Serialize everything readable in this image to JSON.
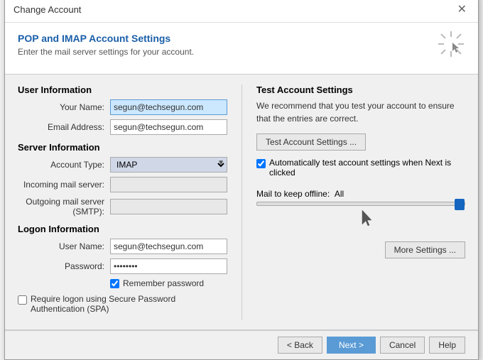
{
  "dialog": {
    "title": "Change Account",
    "close_label": "✕"
  },
  "header": {
    "title": "POP and IMAP Account Settings",
    "subtitle": "Enter the mail server settings for your account."
  },
  "left": {
    "user_info_label": "User Information",
    "your_name_label": "Your Name:",
    "your_name_value": "segun@techsegun.com",
    "email_label": "Email Address:",
    "email_value": "segun@techsegun.com",
    "server_info_label": "Server Information",
    "account_type_label": "Account Type:",
    "account_type_value": "IMAP",
    "incoming_label": "Incoming mail server:",
    "incoming_value": "",
    "outgoing_label": "Outgoing mail server (SMTP):",
    "outgoing_value": "",
    "logon_info_label": "Logon Information",
    "username_label": "User Name:",
    "username_value": "segun@techsegun.com",
    "password_label": "Password:",
    "password_value": "••••••••",
    "remember_password_label": "Remember password",
    "require_spa_label": "Require logon using Secure Password Authentication (SPA)"
  },
  "right": {
    "title": "Test Account Settings",
    "description": "We recommend that you test your account to ensure that the entries are correct.",
    "test_btn_label": "Test Account Settings ...",
    "auto_test_label": "Automatically test account settings when Next is clicked",
    "offline_label": "Mail to keep offline:",
    "offline_value": "All",
    "more_settings_label": "More Settings ..."
  },
  "footer": {
    "back_label": "< Back",
    "next_label": "Next >",
    "cancel_label": "Cancel",
    "help_label": "Help"
  }
}
